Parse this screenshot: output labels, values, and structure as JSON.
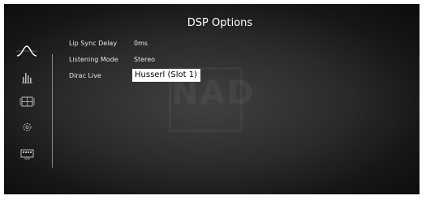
{
  "window": {
    "title": "DSP Options"
  },
  "watermark": {
    "text": "NAD"
  },
  "sidebar": {
    "items": [
      {
        "icon": "waveform-icon"
      },
      {
        "icon": "equalizer-icon"
      },
      {
        "icon": "speaker-layout-icon"
      },
      {
        "icon": "settings-gear-icon"
      },
      {
        "icon": "display-icon"
      }
    ]
  },
  "options": [
    {
      "label": "Lip Sync Delay",
      "value": "0ms"
    },
    {
      "label": "Listening Mode",
      "value": "Stereo"
    },
    {
      "label": "Dirac Live",
      "value": "Husserl (Slot 1)"
    }
  ],
  "colors": {
    "selection_bg": "#ffffff",
    "selection_text": "#000000",
    "text": "#e6e6e6"
  }
}
